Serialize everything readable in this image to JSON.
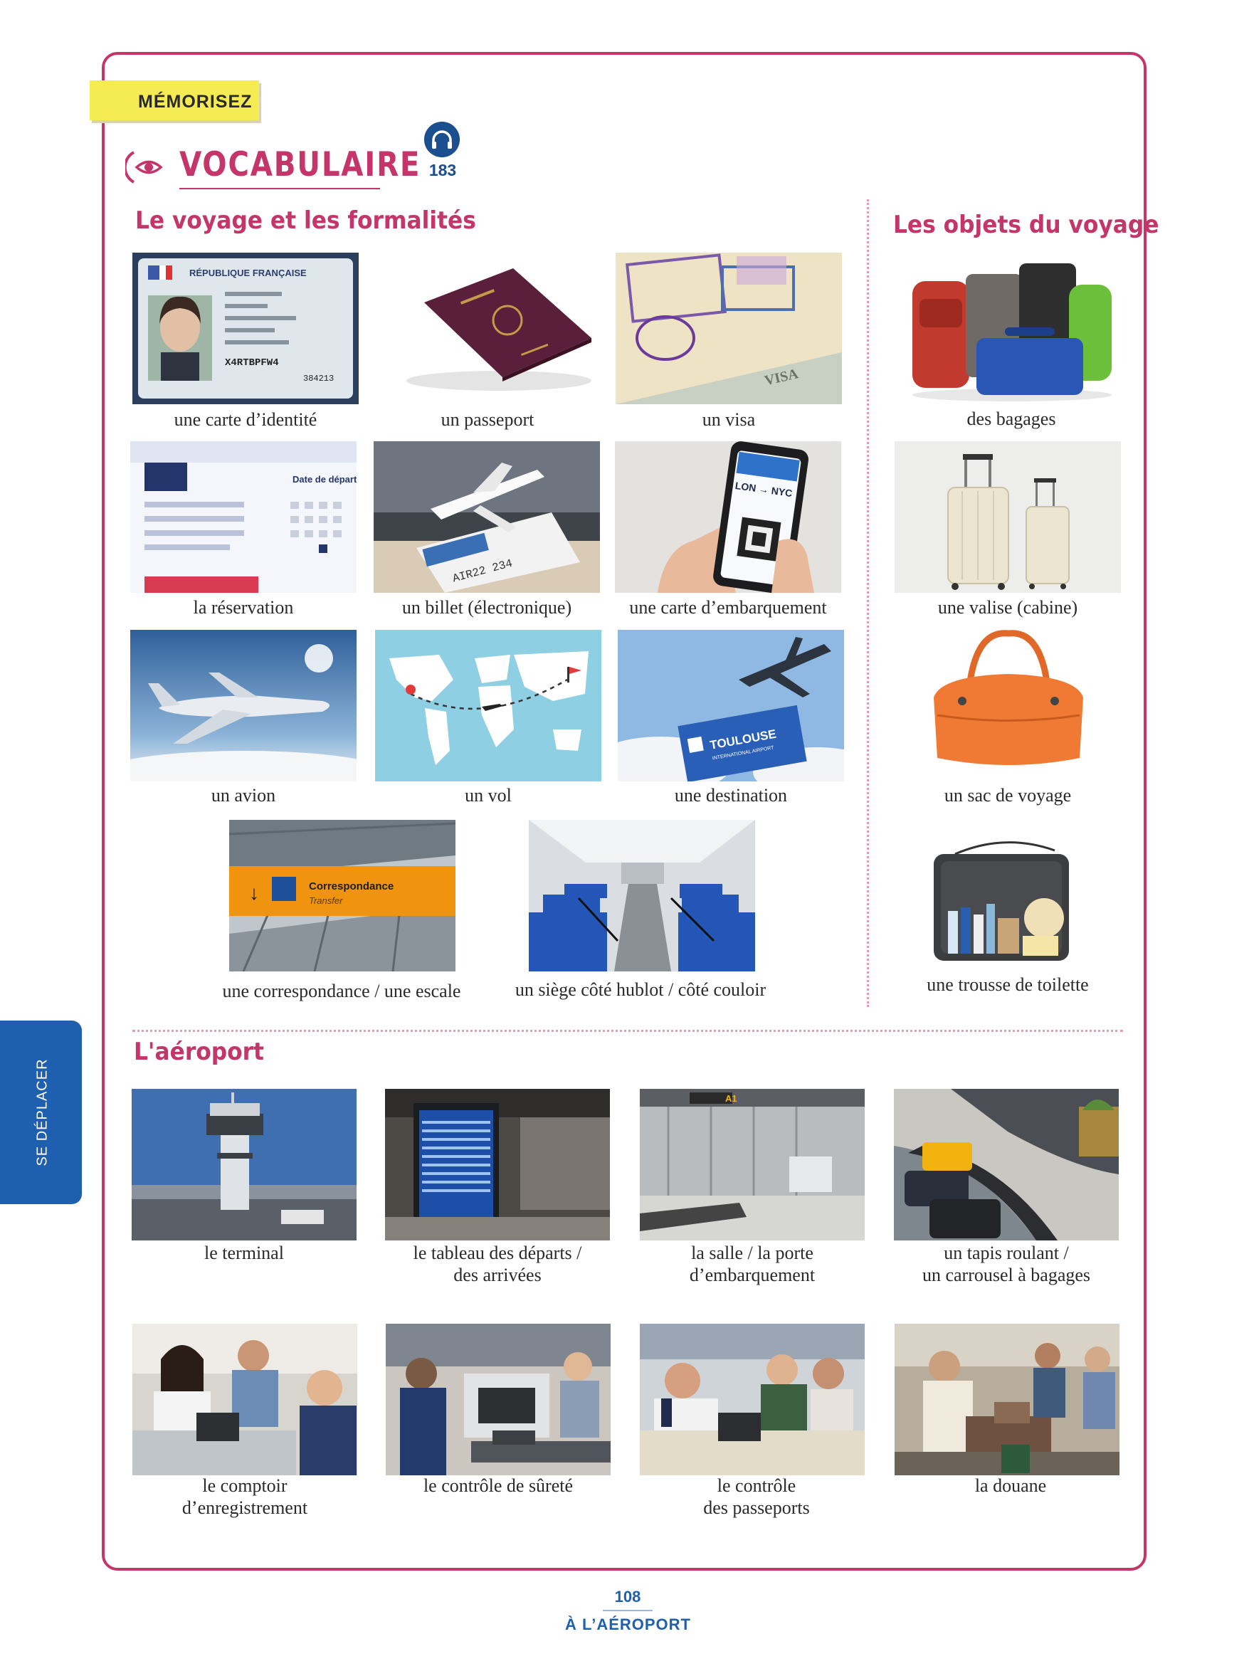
{
  "badge": "MÉMORISEZ",
  "vocabulary_title": "VOCABULAIRE",
  "audio_track": "183",
  "sections": {
    "voyage": "Le voyage et les formalités",
    "objets": "Les objets du voyage",
    "aeroport": "L'aéroport"
  },
  "voyage_items": [
    "une carte d’identité",
    "un passeport",
    "un visa",
    "la réservation",
    "un billet (électronique)",
    "une carte d’embarquement",
    "un avion",
    "un vol",
    "une destination",
    "une correspondance / une escale",
    "un siège côté hublot / côté couloir"
  ],
  "objets_items": [
    "des bagages",
    "une valise (cabine)",
    "un sac de voyage",
    "une trousse de toilette"
  ],
  "aeroport_items": [
    [
      "le terminal"
    ],
    [
      "le tableau des départs /",
      "des arrivées"
    ],
    [
      "la salle / la porte",
      "d’embarquement"
    ],
    [
      "un tapis roulant /",
      "un carrousel à bagages"
    ],
    [
      "le comptoir",
      "d’enregistrement"
    ],
    [
      "le contrôle de sûreté"
    ],
    [
      "le contrôle",
      "des passeports"
    ],
    [
      "la douane"
    ]
  ],
  "photo_text": {
    "id_card": "RÉPUBLIQUE FRANÇAISE",
    "id_number": "X4RTBPFW4",
    "id_small": "384213",
    "reservation": "Date de départ",
    "ticket_code": "AIR22 234",
    "flight": "LON → NYC",
    "sign": "Correspondance",
    "sign_sub": "Transfer",
    "airport_sign": "TOULOUSE",
    "airport_sub": "INTERNATIONAL AIRPORT",
    "visa": "VISA"
  },
  "side_tab": "SE DÉPLACER",
  "page_number": "108",
  "footer": "À L’AÉROPORT",
  "colors": {
    "accent": "#c4356a",
    "blue": "#1e5fb0",
    "badge": "#f4ec52"
  }
}
